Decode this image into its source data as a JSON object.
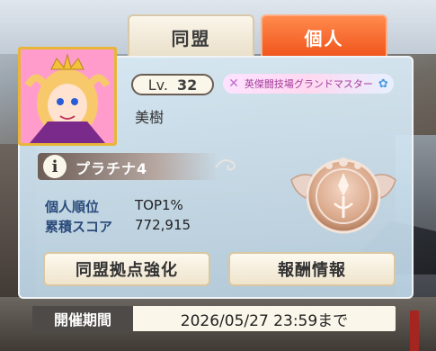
{
  "tabs": {
    "alliance": "同盟",
    "personal": "個人"
  },
  "profile": {
    "level_label": "Lv.",
    "level_value": "32",
    "title_badge": "英傑闘技場グランドマスター",
    "name": "美樹",
    "avatar_icon": "character-portrait-icon"
  },
  "rank": {
    "info_icon": "i",
    "tier": "プラチナ4",
    "personal_rank_label": "個人順位",
    "personal_rank_value": "TOP1%",
    "total_score_label": "累積スコア",
    "total_score_value": "772,915",
    "medal_icon": "platinum-medal-icon"
  },
  "buttons": {
    "alliance_strengthen": "同盟拠点強化",
    "reward_info": "報酬情報"
  },
  "period": {
    "label": "開催期間",
    "value": "2026/05/27 23:59まで"
  },
  "colors": {
    "accent_orange": "#f0531a",
    "panel_blue": "#c4def0",
    "gold_border": "#e7b638"
  }
}
